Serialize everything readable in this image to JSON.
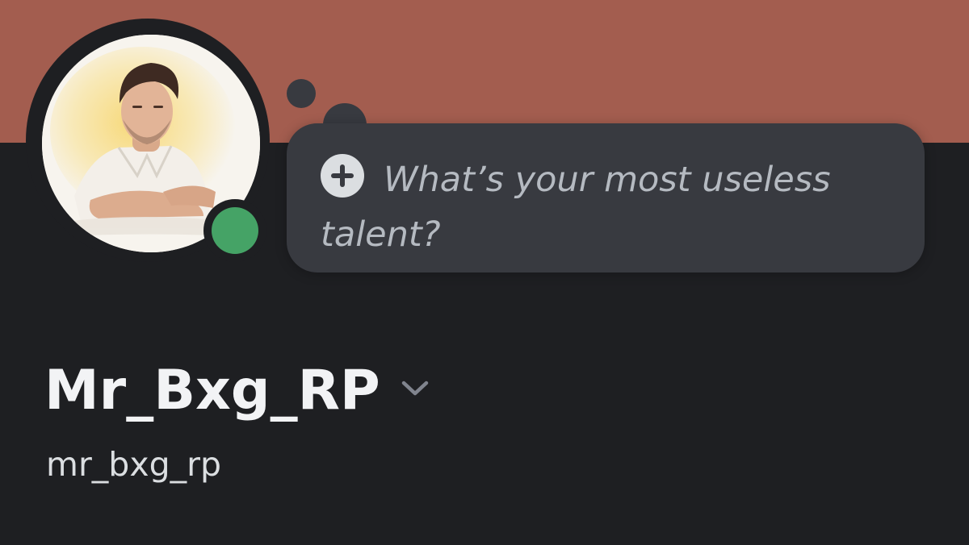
{
  "profile": {
    "display_name": "Mr_Bxg_RP",
    "username": "mr_bxg_rp",
    "status": "online",
    "avatar": "avatar-portrait-man-white-shirt"
  },
  "custom_status": {
    "prompt": "What’s your most useless talent?",
    "icon": "plus-circle-icon"
  },
  "icons": {
    "name_menu": "chevron-down-icon"
  },
  "colors": {
    "banner": "#a35d4f",
    "background": "#1e1f22",
    "bubble": "#383a40",
    "status_online": "#45a366",
    "text_primary": "#f2f3f5",
    "text_muted": "#b5bac1"
  }
}
